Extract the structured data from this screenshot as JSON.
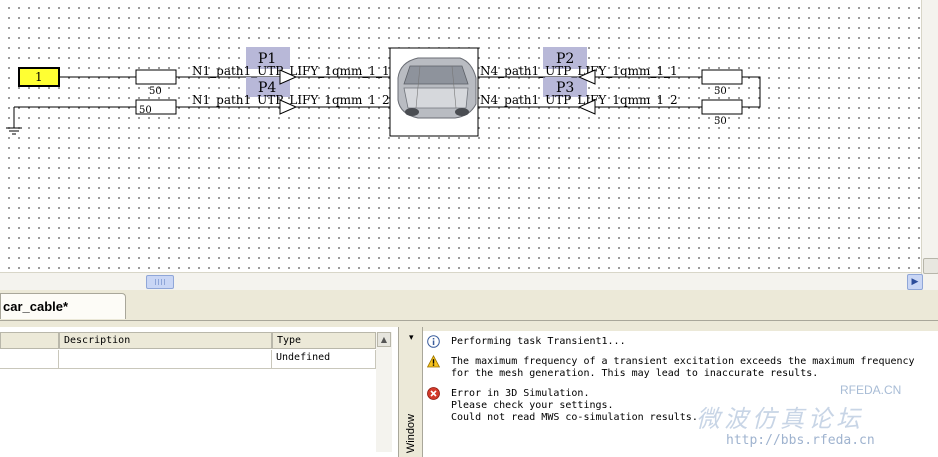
{
  "schematic": {
    "source_value": "1",
    "resistors": [
      "50",
      "50",
      "50",
      "50"
    ],
    "net_labels": [
      "N1_path1_UTP_LIFY_1qmm_1_1",
      "N1_path1_UTP_LIFY_1qmm_1_2",
      "N4_path1_UTP_LIFY_1qmm_1_1",
      "N4_path1_UTP_LIFY_1qmm_1_2"
    ],
    "ports": [
      "P1",
      "P4",
      "P2",
      "P3"
    ],
    "colors": {
      "source_fill": "#ffff33",
      "port_fill": "#b8b8d8"
    }
  },
  "tabs": {
    "active": "car_cable*"
  },
  "param_table": {
    "headers": [
      "",
      "Description",
      "Type"
    ],
    "row": [
      "",
      "",
      "Undefined"
    ]
  },
  "message_window": {
    "title": "Window",
    "pin_icon": "▾",
    "messages": [
      {
        "icon": "info-icon",
        "lines": "Performing task Transient1..."
      },
      {
        "icon": "warning-icon",
        "lines": "The maximum frequency of a transient excitation exceeds the maximum frequency\nfor the mesh generation. This may lead to inaccurate results."
      },
      {
        "icon": "error-icon",
        "lines": "Error in 3D Simulation.\nPlease check your settings.\nCould not read MWS co-simulation results."
      }
    ]
  },
  "watermark": {
    "brand": "RFEDA.CN",
    "chinese": "微波仿真论坛",
    "url": "http://bbs.rfeda.cn"
  }
}
